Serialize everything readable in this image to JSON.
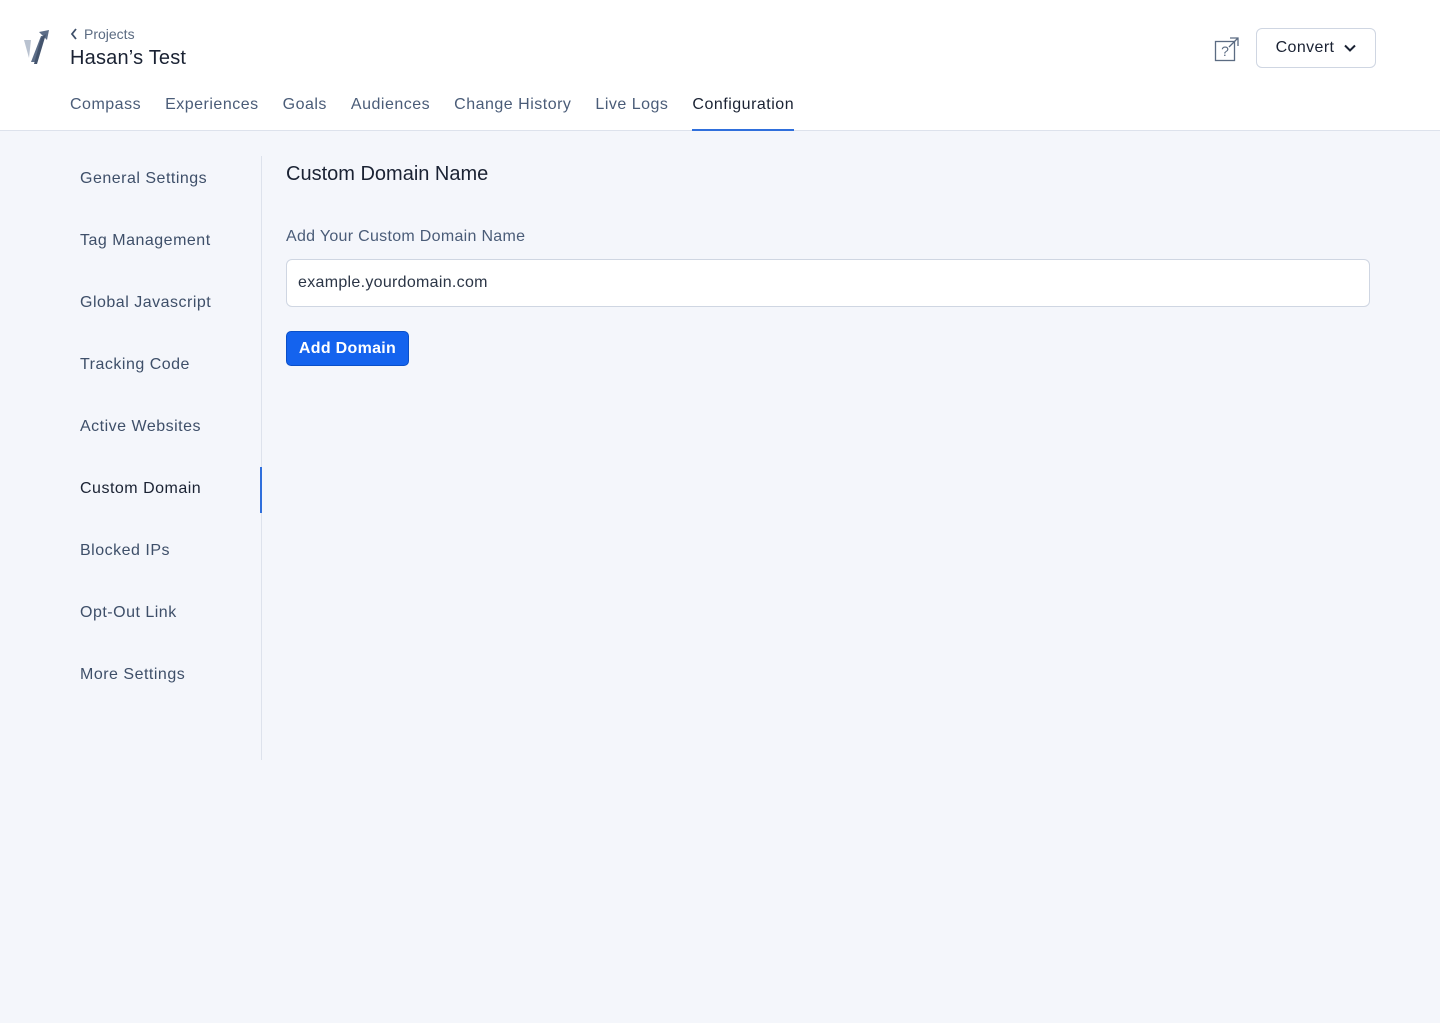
{
  "header": {
    "breadcrumb": "Projects",
    "project_title": "Hasan’s Test",
    "account_label": "Convert",
    "logo_icon": "convert-logo-icon",
    "help_icon": "help-external-icon"
  },
  "tabs": [
    {
      "label": "Compass"
    },
    {
      "label": "Experiences"
    },
    {
      "label": "Goals"
    },
    {
      "label": "Audiences"
    },
    {
      "label": "Change History"
    },
    {
      "label": "Live Logs"
    },
    {
      "label": "Configuration",
      "active": true
    }
  ],
  "sidebar": {
    "items": [
      {
        "label": "General Settings"
      },
      {
        "label": "Tag Management"
      },
      {
        "label": "Global Javascript"
      },
      {
        "label": "Tracking Code"
      },
      {
        "label": "Active Websites"
      },
      {
        "label": "Custom Domain",
        "active": true
      },
      {
        "label": "Blocked IPs"
      },
      {
        "label": "Opt-Out Link"
      },
      {
        "label": "More Settings"
      }
    ]
  },
  "main": {
    "title": "Custom Domain Name",
    "field_label": "Add Your Custom Domain Name",
    "input_placeholder": "example.yourdomain.com",
    "input_value": "",
    "add_button_label": "Add Domain"
  },
  "colors": {
    "accent": "#1463ee",
    "active_indicator": "#2f6fdc",
    "background": "#f4f6fb"
  }
}
